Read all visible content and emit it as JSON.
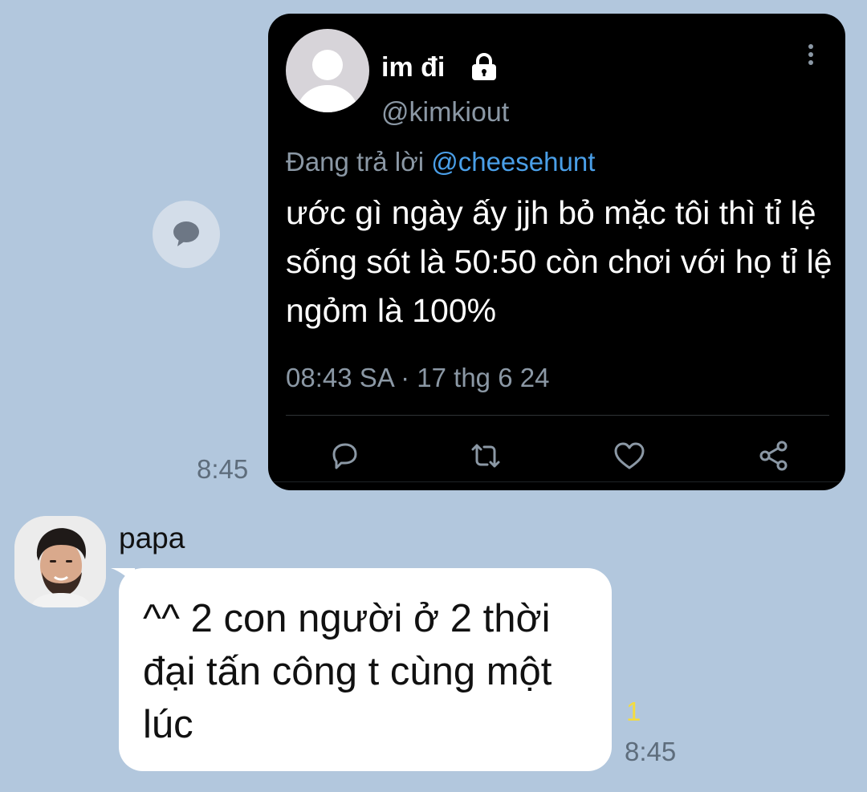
{
  "tweet": {
    "display_name": "im đi",
    "handle": "@kimkiout",
    "reply_prefix": "Đang trả lời",
    "reply_mention": "@cheesehunt",
    "text": "ước gì ngày ấy jjh bỏ mặc tôi thì tỉ lệ sống sót là 50:50 còn chơi với họ tỉ lệ ngỏm là 100%",
    "timestamp": "08:43 SA · 17 thg 6 24",
    "icons": [
      "lock-icon",
      "more-vertical-icon",
      "reply-icon",
      "retweet-icon",
      "like-icon",
      "share-icon"
    ]
  },
  "share_bubble": {
    "icon": "speech-bubble-icon"
  },
  "tweet_message_time": "8:45",
  "incoming": {
    "sender_name": "papa",
    "text": "^^ 2 con người ở 2 thời đại tấn công t cùng một lúc",
    "unread_count": "1",
    "time": "8:45"
  },
  "colors": {
    "chat_background": "#b2c7dd",
    "tweet_background": "#000000",
    "mention_blue": "#4a9fe8",
    "muted_gray": "#8b98a5",
    "unread_yellow": "#f4dc3f"
  }
}
